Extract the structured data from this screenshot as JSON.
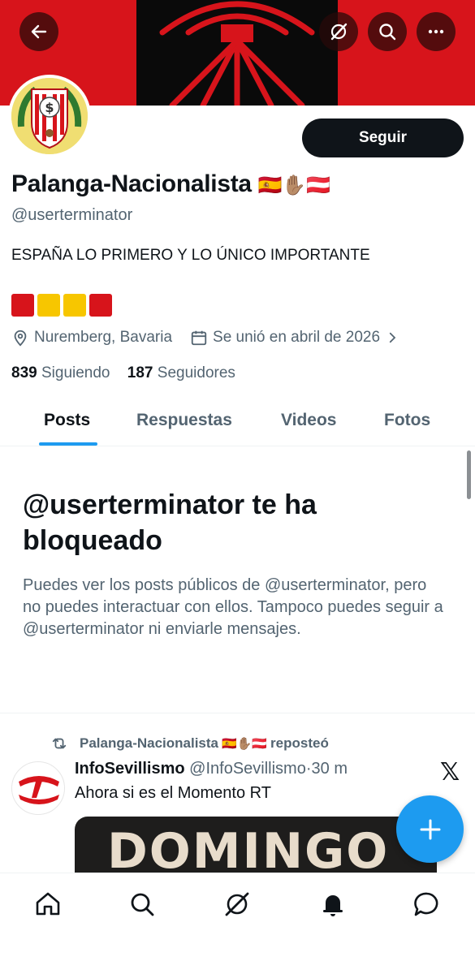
{
  "profile": {
    "name": "Palanga-Nacionalista",
    "name_emojis": "🇪🇸✋🏽🇦🇹",
    "handle": "@userterminator",
    "bio": "ESPAÑA LO PRIMERO Y LO ÚNICO IMPORTANTE",
    "square_colors": [
      "#d7141b",
      "#f7c600",
      "#f7c600",
      "#d7141b"
    ],
    "location": "Nuremberg, Bavaria",
    "joined": "Se unió en abril de 2026",
    "following_count": "839",
    "following_label": "Siguiendo",
    "followers_count": "187",
    "followers_label": "Seguidores",
    "follow_button": "Seguir"
  },
  "header_icons": [
    "back-arrow-icon",
    "grok-icon",
    "search-icon",
    "more-icon"
  ],
  "tabs": [
    {
      "label": "Posts",
      "active": true
    },
    {
      "label": "Respuestas",
      "active": false
    },
    {
      "label": "Videos",
      "active": false
    },
    {
      "label": "Fotos",
      "active": false
    }
  ],
  "blocked": {
    "title": "@userterminator te ha bloqueado",
    "message": "Puedes ver los posts públicos de @userterminator, pero no puedes interactuar con ellos. Tampoco puedes seguir a @userterminator ni enviarle mensajes."
  },
  "post": {
    "repost_by": "Palanga-Nacionalista",
    "repost_emojis": "🇪🇸✋🏽🇦🇹",
    "repost_suffix": "reposteó",
    "author_name": "InfoSevillismo",
    "author_handle": "@InfoSevillismo",
    "separator": "·",
    "time": "30 m",
    "text": "Ahora si es el Momento RT",
    "media_text": "DOMINGO"
  },
  "bottom_nav": [
    "home-icon",
    "search-icon",
    "grok-icon",
    "notifications-icon",
    "messages-icon"
  ],
  "colors": {
    "accent": "#1d9bf0",
    "banner_red": "#d7141b",
    "text": "#0f1419",
    "muted": "#536471"
  }
}
